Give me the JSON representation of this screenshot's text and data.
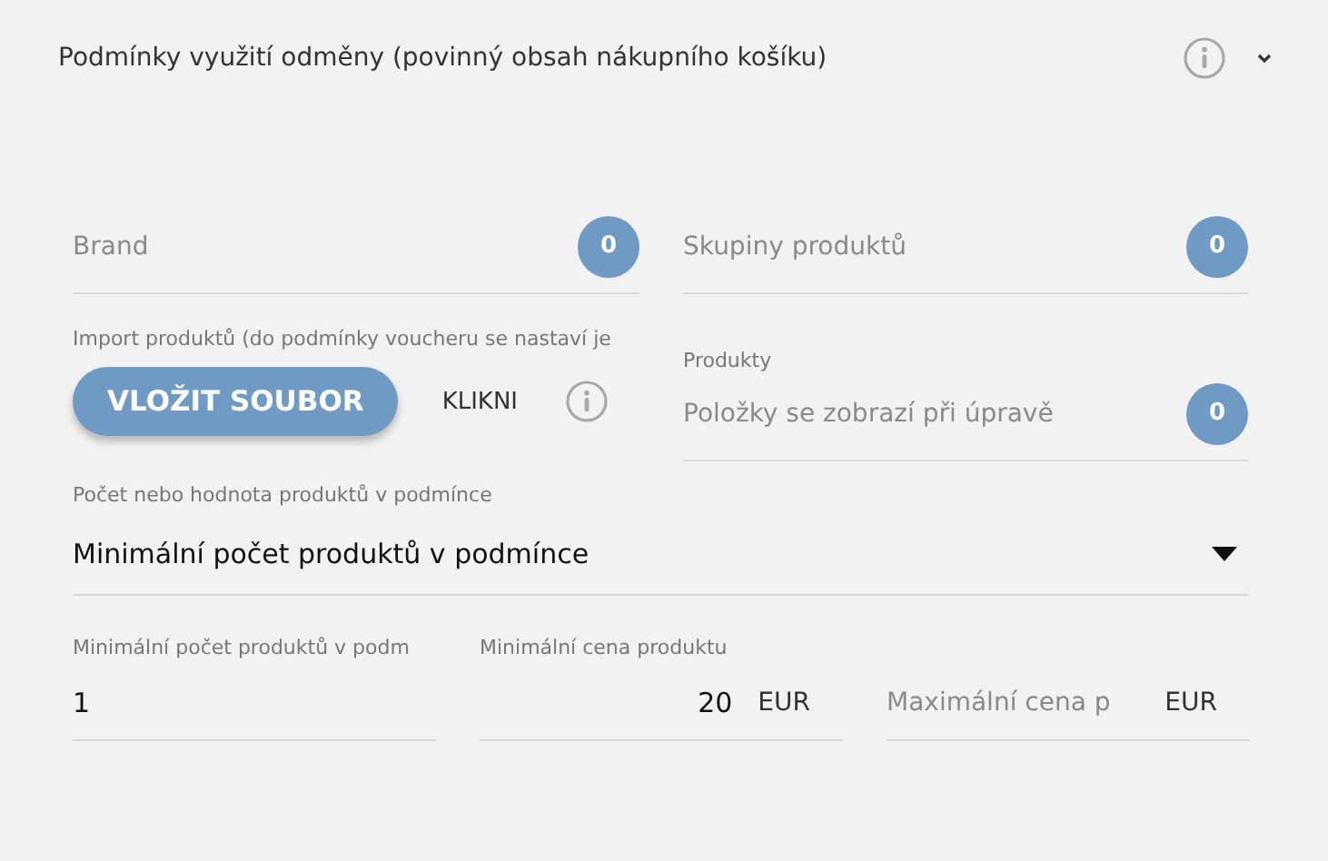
{
  "section": {
    "title": "Podmínky využití odměny (povinný obsah nákupního košíku)",
    "expanded": true
  },
  "pickers": [
    {
      "label": "Brand",
      "count": "0"
    },
    {
      "label": "Skupiny produktů",
      "count": "0"
    }
  ],
  "import": {
    "label": "Import produktů (do podmínky voucheru se nastaví je",
    "button": "VLOŽIT SOUBOR",
    "hint": "KLIKNI"
  },
  "products": {
    "label": "Produkty",
    "placeholder": "Položky se zobrazí při úpravě",
    "count": "0"
  },
  "condition": {
    "label": "Počet nebo hodnota produktů v podmínce",
    "value": "Minimální počet produktů v podmínce"
  },
  "min_count": {
    "label": "Minimální počet produktů v podm",
    "value": "1"
  },
  "min_price": {
    "label": "Minimální cena produktu",
    "value": "20",
    "unit": "EUR"
  },
  "max_price": {
    "placeholder": "Maximální cena p",
    "unit": "EUR"
  }
}
